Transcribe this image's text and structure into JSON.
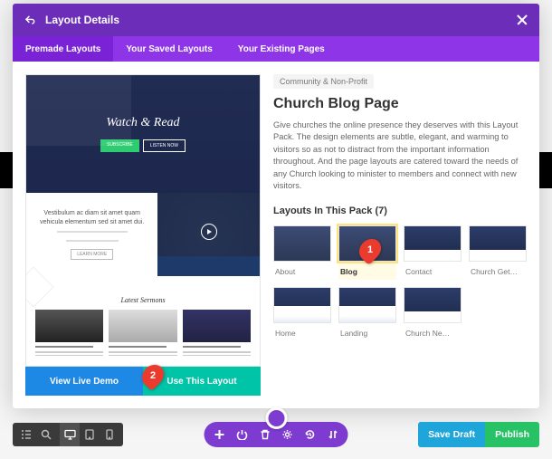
{
  "header": {
    "title": "Layout Details"
  },
  "tabs": [
    {
      "label": "Premade Layouts",
      "active": true
    },
    {
      "label": "Your Saved Layouts",
      "active": false
    },
    {
      "label": "Your Existing Pages",
      "active": false
    }
  ],
  "preview": {
    "hero_text": "Watch & Read",
    "sermons_label": "Latest Sermons",
    "vestib": "Vestibulum ac diam sit amet quam vehicula elementum sed sit amet dui.",
    "learn": "LEARN MORE",
    "sub": "SUBSCRIBE",
    "listen": "LISTEN NOW"
  },
  "actions": {
    "demo": "View Live Demo",
    "use": "Use This Layout"
  },
  "details": {
    "category": "Community & Non-Profit",
    "title": "Church Blog Page",
    "description": "Give churches the online presence they deserves with this Layout Pack. The design elements are subtle, elegant, and warming to visitors so as not to distract from the important information throughout. And the page layouts are catered toward the needs of any Church looking to minister to members and connect with new visitors.",
    "pack_label": "Layouts In This Pack (7)"
  },
  "thumbs": [
    {
      "label": "About"
    },
    {
      "label": "Blog",
      "selected": true
    },
    {
      "label": "Contact"
    },
    {
      "label": "Church Get…"
    },
    {
      "label": "Home"
    },
    {
      "label": "Landing"
    },
    {
      "label": "Church Ne…"
    }
  ],
  "callouts": {
    "c1": "1",
    "c2": "2"
  },
  "bottom": {
    "save_draft": "Save Draft",
    "publish": "Publish"
  }
}
